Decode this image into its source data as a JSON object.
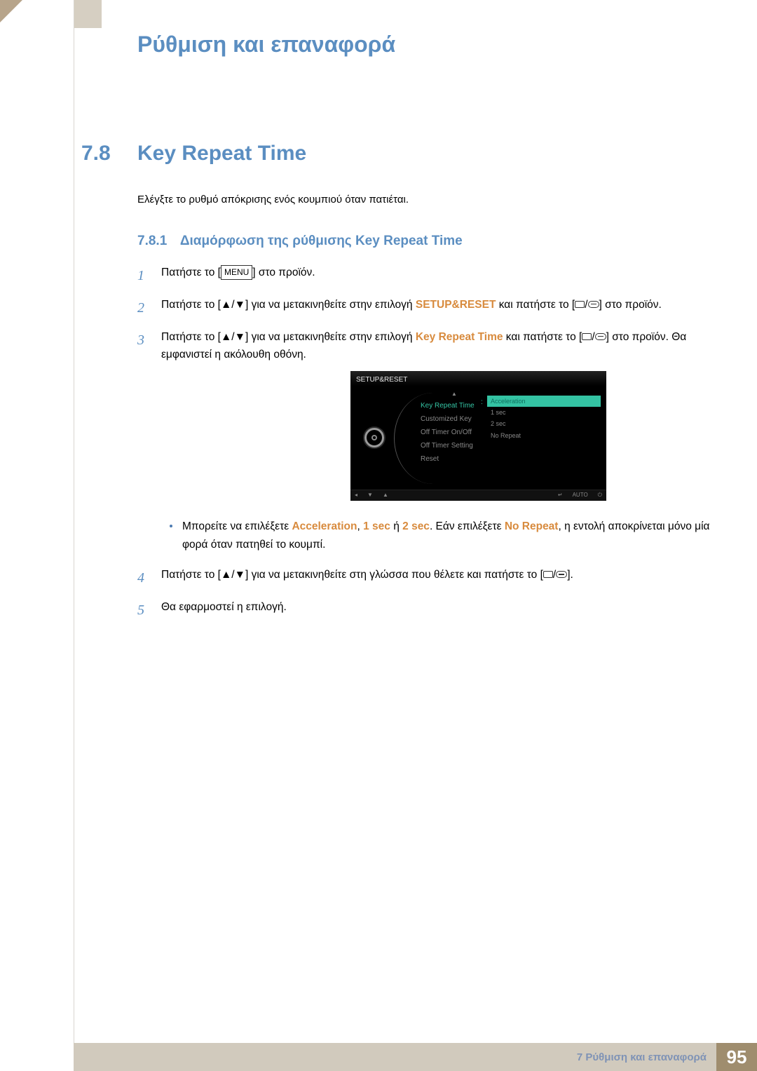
{
  "chapter": {
    "title": "Ρύθμιση και επαναφορά"
  },
  "section": {
    "number": "7.8",
    "title": "Key Repeat Time"
  },
  "intro": "Ελέγξτε το ρυθμό απόκρισης ενός κουμπιού όταν πατιέται.",
  "subsection": {
    "number": "7.8.1",
    "title": "Διαμόρφωση της ρύθμισης Key Repeat Time"
  },
  "steps": {
    "s1": {
      "num": "1",
      "a": "Πατήστε το [",
      "menu": "MENU",
      "b": "] στο προϊόν."
    },
    "s2": {
      "num": "2",
      "a": "Πατήστε το [",
      "arrows": "▲/▼",
      "b": "] για να μετακινηθείτε στην επιλογή ",
      "hl": "SETUP&RESET",
      "c": " και πατήστε το [",
      "slash": "/",
      "d": "] στο προϊόν."
    },
    "s3": {
      "num": "3",
      "a": "Πατήστε το [",
      "arrows": "▲/▼",
      "b": "] για να μετακινηθείτε στην επιλογή ",
      "hl": "Key Repeat Time",
      "c": " και πατήστε το [",
      "slash": "/",
      "d": "] στο προϊόν. Θα εμφανιστεί η ακόλουθη οθόνη."
    },
    "s4": {
      "num": "4",
      "a": "Πατήστε το [",
      "arrows": "▲/▼",
      "b": "] για να μετακινηθείτε στη γλώσσα που θέλετε και πατήστε το [",
      "slash": "/",
      "c": "]."
    },
    "s5": {
      "num": "5",
      "a": "Θα εφαρμοστεί η επιλογή."
    }
  },
  "bullet": {
    "a": "Μπορείτε να επιλέξετε ",
    "h1": "Acceleration",
    "comma": ", ",
    "h2": "1 sec",
    "or": " ή ",
    "h3": "2 sec",
    "b": ". Εάν επιλέξετε ",
    "h4": "No Repeat",
    "c": ", η εντολή αποκρίνεται μόνο μία φορά όταν πατηθεί το κουμπί."
  },
  "osd": {
    "header": "SETUP&RESET",
    "menu": {
      "i1": "Key Repeat Time",
      "i2": "Customized Key",
      "i3": "Off Timer On/Off",
      "i4": "Off Timer Setting",
      "i5": "Reset"
    },
    "options": {
      "o1": "Acceleration",
      "o2": "1 sec",
      "o3": "2 sec",
      "o4": "No Repeat"
    },
    "footer": {
      "auto": "AUTO"
    }
  },
  "footer": {
    "text": "7 Ρύθμιση και επαναφορά",
    "page": "95"
  }
}
